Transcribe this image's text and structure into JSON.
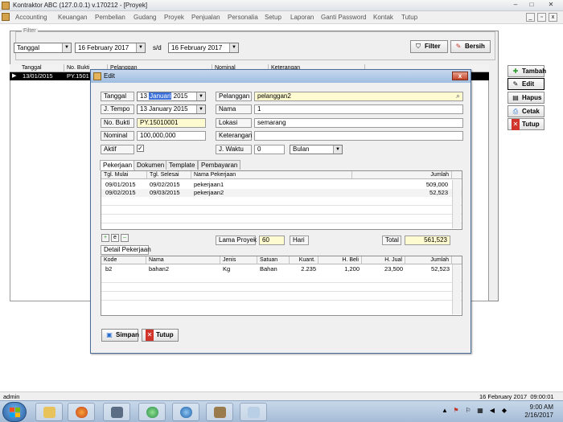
{
  "window": {
    "title": "Kontraktor ABC (127.0.0.1) v.170212 - [Proyek]",
    "minimize": "–",
    "maximize": "□",
    "close": "✕"
  },
  "menu": [
    "Accounting",
    "Keuangan",
    "Pembelian",
    "Gudang",
    "Proyek",
    "Penjualan",
    "Personalia",
    "Setup",
    "Laporan",
    "Ganti Password",
    "Kontak",
    "Tutup"
  ],
  "filter": {
    "legend": "Filter",
    "field": "Tanggal",
    "date_from": "16  February  2017",
    "sd": "s/d",
    "date_to": "16  February  2017",
    "filter_btn": "Filter",
    "bersih_btn": "Bersih"
  },
  "list_grid": {
    "columns": [
      "Tanggal",
      "No. Bukti",
      "Pelanggan",
      "Nominal",
      "Keterangan"
    ],
    "row": {
      "marker": "▶",
      "tanggal": "13/01/2015",
      "nobukti": "PY.1501"
    }
  },
  "side_buttons": {
    "tambah": "Tambah",
    "edit": "Edit",
    "hapus": "Hapus",
    "cetak": "Cetak",
    "tutup": "Tutup"
  },
  "dialog": {
    "title": "Edit",
    "close": "x",
    "labels": {
      "tanggal": "Tanggal",
      "jtempo": "J. Tempo",
      "nobukti": "No. Bukti",
      "nominal": "Nominal",
      "aktif": "Aktif",
      "pelanggan": "Pelanggan",
      "nama": "Nama",
      "lokasi": "Lokasi",
      "keterangan": "Keterangan",
      "jwaktu": "J. Waktu"
    },
    "values": {
      "tanggal_day": "13",
      "tanggal_month": "Januari",
      "tanggal_year": "2015",
      "jtempo": "13  January  2015",
      "nobukti": "PY.15010001",
      "nominal": "100,000,000",
      "aktif_check": "✓",
      "pelanggan": "pelanggan2",
      "nama": "1",
      "lokasi": "semarang",
      "keterangan": "",
      "jwaktu_num": "0",
      "jwaktu_unit": "Bulan"
    },
    "tabs": [
      "Pekerjaan",
      "Dokumen",
      "Template",
      "Pembayaran"
    ],
    "pekerjaan_grid": {
      "columns": [
        "Tgl. Mulai",
        "Tgl. Selesai",
        "Nama Pekerjaan",
        "Jumlah"
      ],
      "rows": [
        {
          "mulai": "09/01/2015",
          "selesai": "09/02/2015",
          "nama": "pekerjaan1",
          "jumlah": "509,000"
        },
        {
          "mulai": "09/02/2015",
          "selesai": "09/03/2015",
          "nama": "pekerjaan2",
          "jumlah": "52,523"
        }
      ]
    },
    "mini_buttons": {
      "add": "+",
      "edit": "e",
      "del": "–"
    },
    "lama_proyek_label": "Lama Proyek",
    "lama_proyek_value": "60",
    "hari": "Hari",
    "total_label": "Total",
    "total_value": "561,523",
    "detail_tab": "Detail Pekerjaan",
    "detail_grid": {
      "columns": [
        "Kode",
        "Nama",
        "Jenis",
        "Satuan",
        "Kuant.",
        "H. Beli",
        "H. Jual",
        "Jumlah"
      ],
      "rows": [
        {
          "kode": "b2",
          "nama": "bahan2",
          "jenis": "Kg",
          "satuan": "Bahan",
          "kuant": "2.235",
          "hbeli": "1,200",
          "hjual": "23,500",
          "jumlah": "52,523"
        }
      ]
    },
    "simpan": "Simpan",
    "tutup": "Tutup"
  },
  "statusbar": {
    "user": "admin",
    "datetime": "16 February 2017  09:00:01"
  },
  "taskbar": {
    "time": "9:00 AM",
    "date": "2/16/2017"
  },
  "colors": {
    "accent": "#3a6fd8",
    "yellow_field": "#fffbd0",
    "selected_row": "#000000"
  }
}
